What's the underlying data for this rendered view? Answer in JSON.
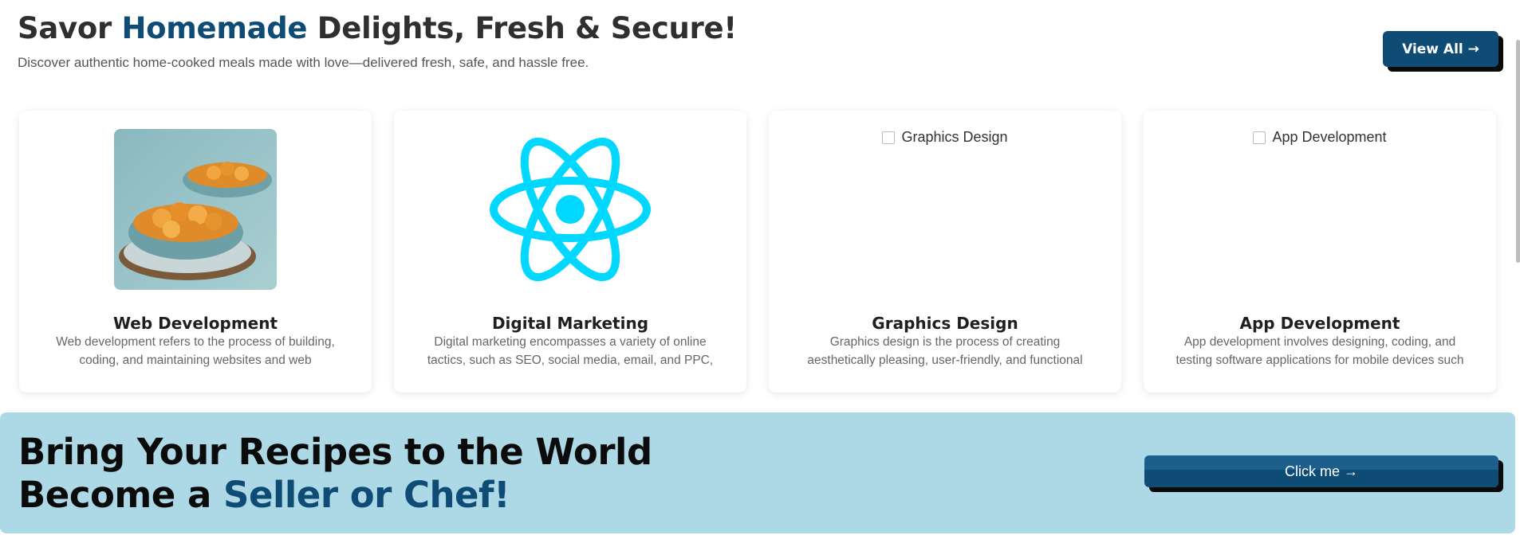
{
  "header": {
    "title_pre": "Savor ",
    "title_accent": "Homemade",
    "title_post": " Delights, Fresh & Secure!",
    "subtitle": "Discover authentic home-cooked meals made with love—delivered fresh, safe, and hassle free.",
    "view_all_label": "View All →"
  },
  "cards": [
    {
      "title": "Web Development",
      "description": "Web development refers to the process of building, coding, and maintaining websites and web",
      "image": "food-bowls-photo"
    },
    {
      "title": "Digital Marketing",
      "description": "Digital marketing encompasses a variety of online tactics, such as SEO, social media, email, and PPC, to",
      "image": "react-atom-logo"
    },
    {
      "title": "Graphics Design",
      "description": "Graphics design is the process of creating aesthetically pleasing, user-friendly, and functional",
      "image_alt": "Graphics Design"
    },
    {
      "title": "App Development",
      "description": "App development involves designing, coding, and testing software applications for mobile devices such",
      "image_alt": "App Development"
    }
  ],
  "cta": {
    "line1": "Bring Your Recipes to the World",
    "line2_pre": "Become a ",
    "line2_accent": "Seller or Chef!",
    "button_label": "Click me →"
  },
  "colors": {
    "accent": "#0f4c75",
    "cta_background": "#add8e6",
    "react_logo": "#00d8ff"
  }
}
